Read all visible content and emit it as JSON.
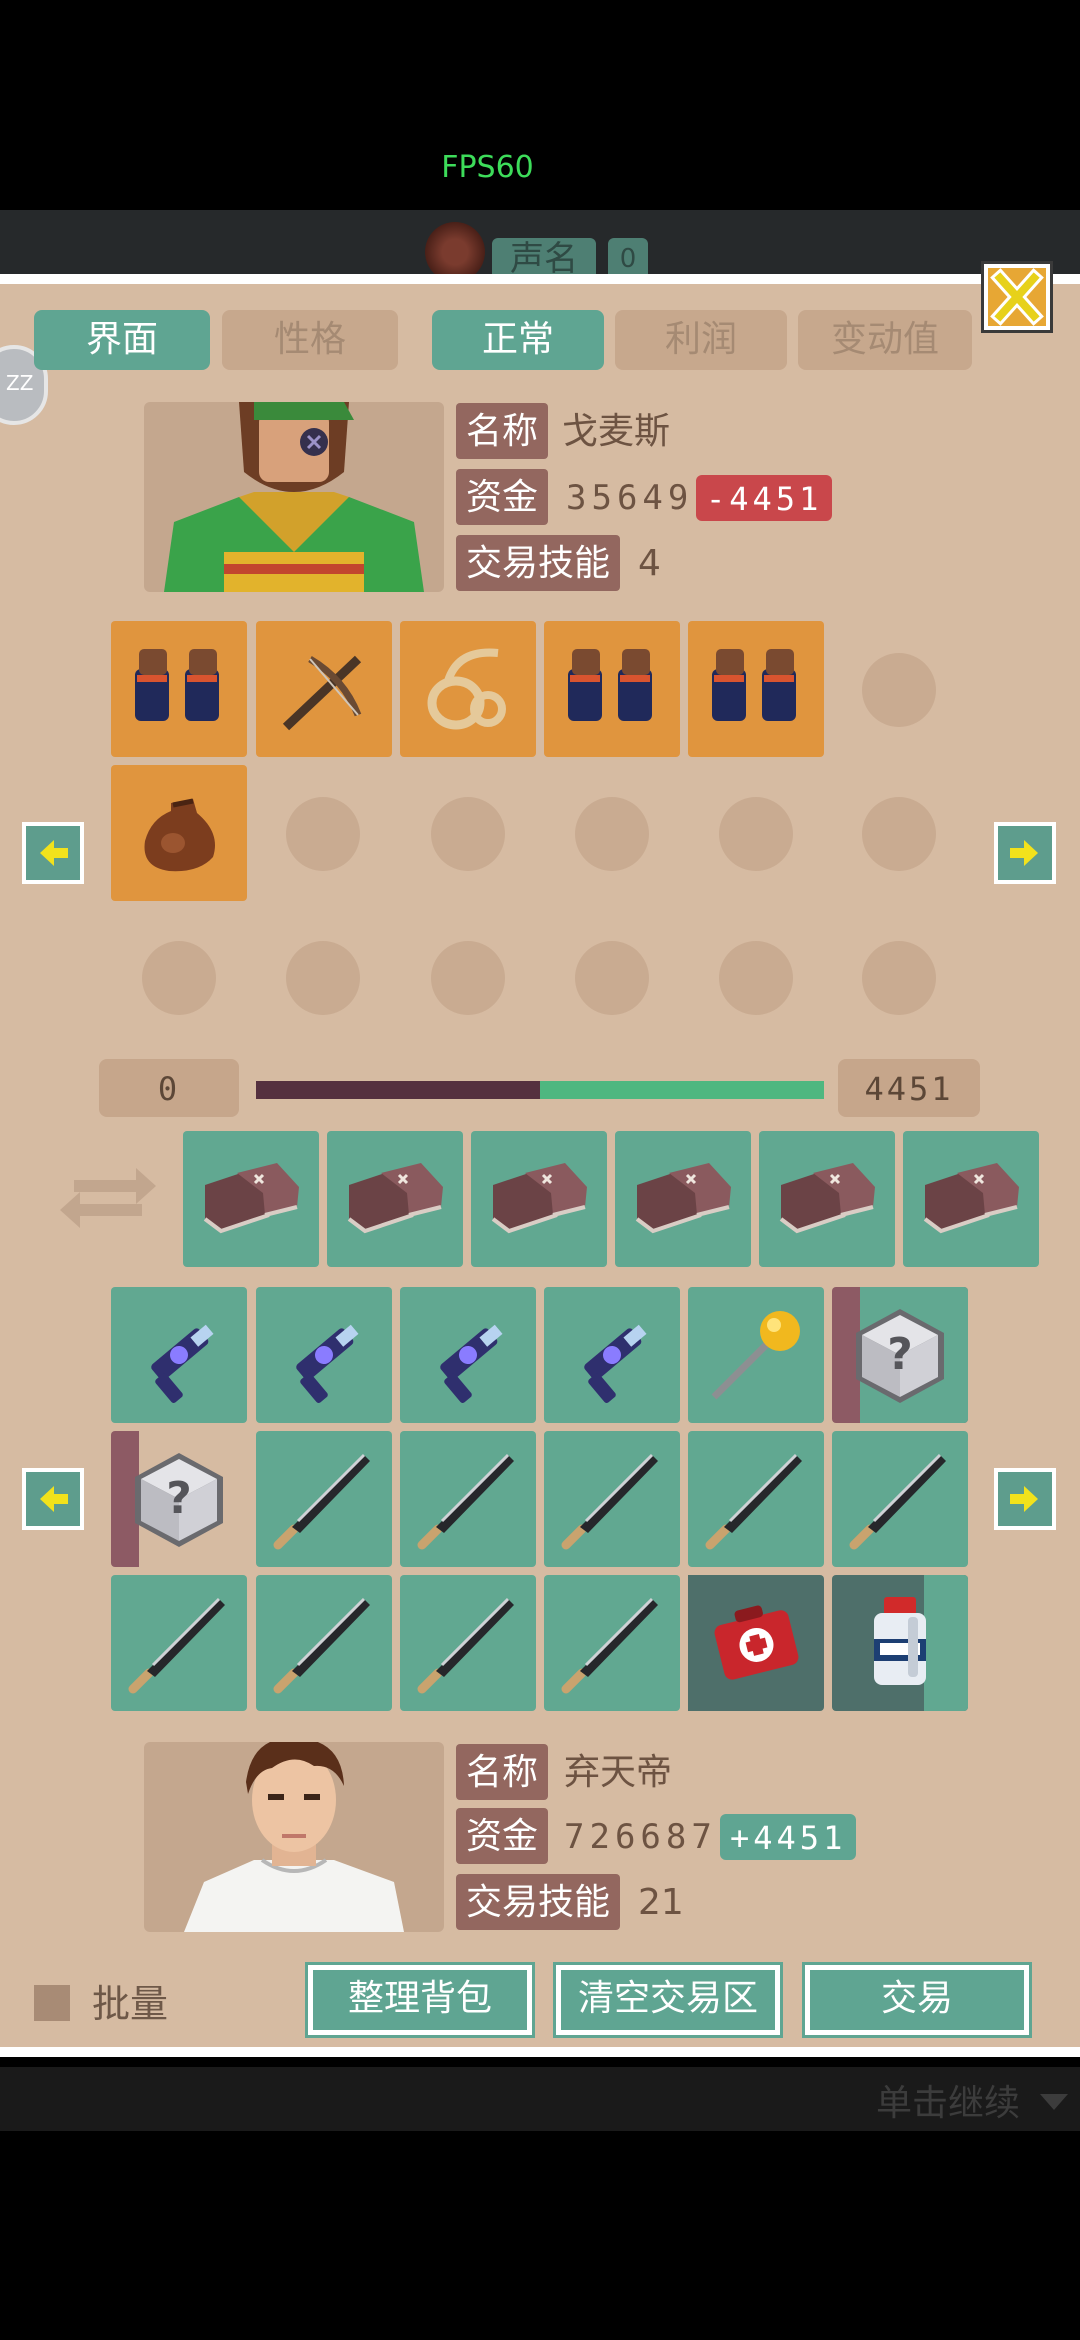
{
  "hud": {
    "fps": "FPS60"
  },
  "peek": {
    "name": "声名",
    "count": "0"
  },
  "tabs": [
    {
      "label": "界面",
      "active": true
    },
    {
      "label": "性格",
      "active": false
    },
    {
      "label": "正常",
      "active": true
    },
    {
      "label": "利润",
      "active": false
    },
    {
      "label": "变动值",
      "active": false
    }
  ],
  "merchant": {
    "name_label": "名称",
    "name": "戈麦斯",
    "funds_label": "资金",
    "funds": "35649",
    "funds_change": "-4451",
    "skill_label": "交易技能",
    "skill": "4"
  },
  "merchant_inventory": {
    "row1": [
      "gauntlet-icon",
      "crossbow-icon",
      "rope-icon",
      "gauntlet-icon",
      "gauntlet-icon"
    ],
    "row2": [
      "pouch-icon"
    ]
  },
  "trade_balance": {
    "left": "0",
    "right": "4451",
    "fill_fraction": 0.5
  },
  "trade_area": [
    "leather-shoes-icon",
    "leather-shoes-icon",
    "leather-shoes-icon",
    "leather-shoes-icon",
    "leather-shoes-icon",
    "leather-shoes-icon"
  ],
  "player_inventory": {
    "row1": [
      "energy-gun-icon",
      "energy-gun-icon",
      "energy-gun-icon",
      "energy-gun-icon",
      "golden-staff-icon",
      "mystery-cube-icon"
    ],
    "row2": [
      "mystery-cube-icon",
      "machete-icon",
      "machete-icon",
      "machete-icon",
      "machete-icon",
      "machete-icon"
    ],
    "row3": [
      "machete-icon",
      "machete-icon",
      "machete-icon",
      "machete-icon",
      "medkit-icon",
      "medicine-bottle-icon"
    ]
  },
  "player": {
    "name_label": "名称",
    "name": "弃天帝",
    "funds_label": "资金",
    "funds": "726687",
    "funds_change": "+4451",
    "skill_label": "交易技能",
    "skill": "21"
  },
  "footer": {
    "batch_label": "批量",
    "sort_label": "整理背包",
    "clear_label": "清空交易区",
    "trade_label": "交易",
    "continue_label": "单击继续"
  },
  "colors": {
    "panel": "#d6bba2",
    "active_tab": "#5fa592",
    "negative": "#c9474b",
    "positive": "#5fa592",
    "orange_slot": "#e0953e",
    "green_slot": "#61a891"
  }
}
